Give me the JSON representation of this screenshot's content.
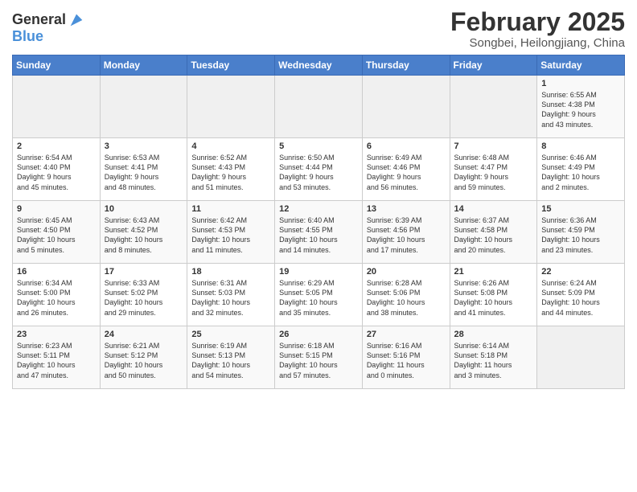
{
  "logo": {
    "line1": "General",
    "line2": "Blue"
  },
  "title": "February 2025",
  "location": "Songbei, Heilongjiang, China",
  "days_of_week": [
    "Sunday",
    "Monday",
    "Tuesday",
    "Wednesday",
    "Thursday",
    "Friday",
    "Saturday"
  ],
  "weeks": [
    [
      {
        "day": "",
        "info": ""
      },
      {
        "day": "",
        "info": ""
      },
      {
        "day": "",
        "info": ""
      },
      {
        "day": "",
        "info": ""
      },
      {
        "day": "",
        "info": ""
      },
      {
        "day": "",
        "info": ""
      },
      {
        "day": "1",
        "info": "Sunrise: 6:55 AM\nSunset: 4:38 PM\nDaylight: 9 hours\nand 43 minutes."
      }
    ],
    [
      {
        "day": "2",
        "info": "Sunrise: 6:54 AM\nSunset: 4:40 PM\nDaylight: 9 hours\nand 45 minutes."
      },
      {
        "day": "3",
        "info": "Sunrise: 6:53 AM\nSunset: 4:41 PM\nDaylight: 9 hours\nand 48 minutes."
      },
      {
        "day": "4",
        "info": "Sunrise: 6:52 AM\nSunset: 4:43 PM\nDaylight: 9 hours\nand 51 minutes."
      },
      {
        "day": "5",
        "info": "Sunrise: 6:50 AM\nSunset: 4:44 PM\nDaylight: 9 hours\nand 53 minutes."
      },
      {
        "day": "6",
        "info": "Sunrise: 6:49 AM\nSunset: 4:46 PM\nDaylight: 9 hours\nand 56 minutes."
      },
      {
        "day": "7",
        "info": "Sunrise: 6:48 AM\nSunset: 4:47 PM\nDaylight: 9 hours\nand 59 minutes."
      },
      {
        "day": "8",
        "info": "Sunrise: 6:46 AM\nSunset: 4:49 PM\nDaylight: 10 hours\nand 2 minutes."
      }
    ],
    [
      {
        "day": "9",
        "info": "Sunrise: 6:45 AM\nSunset: 4:50 PM\nDaylight: 10 hours\nand 5 minutes."
      },
      {
        "day": "10",
        "info": "Sunrise: 6:43 AM\nSunset: 4:52 PM\nDaylight: 10 hours\nand 8 minutes."
      },
      {
        "day": "11",
        "info": "Sunrise: 6:42 AM\nSunset: 4:53 PM\nDaylight: 10 hours\nand 11 minutes."
      },
      {
        "day": "12",
        "info": "Sunrise: 6:40 AM\nSunset: 4:55 PM\nDaylight: 10 hours\nand 14 minutes."
      },
      {
        "day": "13",
        "info": "Sunrise: 6:39 AM\nSunset: 4:56 PM\nDaylight: 10 hours\nand 17 minutes."
      },
      {
        "day": "14",
        "info": "Sunrise: 6:37 AM\nSunset: 4:58 PM\nDaylight: 10 hours\nand 20 minutes."
      },
      {
        "day": "15",
        "info": "Sunrise: 6:36 AM\nSunset: 4:59 PM\nDaylight: 10 hours\nand 23 minutes."
      }
    ],
    [
      {
        "day": "16",
        "info": "Sunrise: 6:34 AM\nSunset: 5:00 PM\nDaylight: 10 hours\nand 26 minutes."
      },
      {
        "day": "17",
        "info": "Sunrise: 6:33 AM\nSunset: 5:02 PM\nDaylight: 10 hours\nand 29 minutes."
      },
      {
        "day": "18",
        "info": "Sunrise: 6:31 AM\nSunset: 5:03 PM\nDaylight: 10 hours\nand 32 minutes."
      },
      {
        "day": "19",
        "info": "Sunrise: 6:29 AM\nSunset: 5:05 PM\nDaylight: 10 hours\nand 35 minutes."
      },
      {
        "day": "20",
        "info": "Sunrise: 6:28 AM\nSunset: 5:06 PM\nDaylight: 10 hours\nand 38 minutes."
      },
      {
        "day": "21",
        "info": "Sunrise: 6:26 AM\nSunset: 5:08 PM\nDaylight: 10 hours\nand 41 minutes."
      },
      {
        "day": "22",
        "info": "Sunrise: 6:24 AM\nSunset: 5:09 PM\nDaylight: 10 hours\nand 44 minutes."
      }
    ],
    [
      {
        "day": "23",
        "info": "Sunrise: 6:23 AM\nSunset: 5:11 PM\nDaylight: 10 hours\nand 47 minutes."
      },
      {
        "day": "24",
        "info": "Sunrise: 6:21 AM\nSunset: 5:12 PM\nDaylight: 10 hours\nand 50 minutes."
      },
      {
        "day": "25",
        "info": "Sunrise: 6:19 AM\nSunset: 5:13 PM\nDaylight: 10 hours\nand 54 minutes."
      },
      {
        "day": "26",
        "info": "Sunrise: 6:18 AM\nSunset: 5:15 PM\nDaylight: 10 hours\nand 57 minutes."
      },
      {
        "day": "27",
        "info": "Sunrise: 6:16 AM\nSunset: 5:16 PM\nDaylight: 11 hours\nand 0 minutes."
      },
      {
        "day": "28",
        "info": "Sunrise: 6:14 AM\nSunset: 5:18 PM\nDaylight: 11 hours\nand 3 minutes."
      },
      {
        "day": "",
        "info": ""
      }
    ]
  ]
}
